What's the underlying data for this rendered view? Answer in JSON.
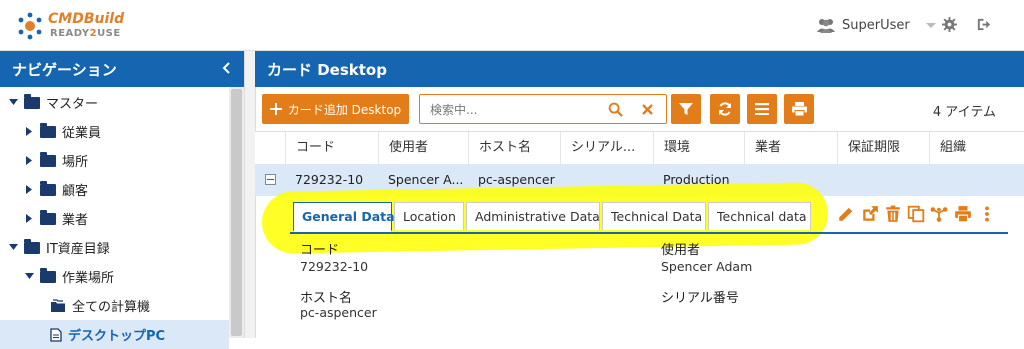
{
  "app": {
    "logo_line1": "CMDBuild",
    "logo_line2_pre": "READY",
    "logo_line2_mid": "2",
    "logo_line2_post": "USE",
    "user_name": "SuperUser"
  },
  "nav": {
    "title": "ナビゲーション",
    "items": [
      {
        "label": "マスター",
        "expanded": true,
        "level": 0
      },
      {
        "label": "従業員",
        "expanded": false,
        "level": 1
      },
      {
        "label": "場所",
        "expanded": false,
        "level": 1
      },
      {
        "label": "顧客",
        "expanded": false,
        "level": 1
      },
      {
        "label": "業者",
        "expanded": false,
        "level": 1
      },
      {
        "label": "IT資産目録",
        "expanded": true,
        "level": 0
      },
      {
        "label": "作業場所",
        "expanded": true,
        "level": 1
      },
      {
        "label": "全ての計算機",
        "level": 2
      },
      {
        "label": "デスクトップPC",
        "level": 2,
        "selected": true
      }
    ]
  },
  "main": {
    "title": "カード Desktop",
    "add_button": "カード追加 Desktop",
    "search_placeholder": "検索中...",
    "item_count": "4 アイテム"
  },
  "grid": {
    "columns": [
      "コード",
      "使用者",
      "ホスト名",
      "シリアル...",
      "環境",
      "業者",
      "保証期限",
      "組織"
    ],
    "rows": [
      [
        "729232-10",
        "Spencer A...",
        "pc-aspencer",
        "",
        "Production",
        "",
        "",
        ""
      ]
    ]
  },
  "detail": {
    "tabs": [
      "General Data",
      "Location",
      "Administrative Data",
      "Technical Data",
      "Technical data"
    ],
    "active_tab": "General Data",
    "fields": [
      {
        "label": "コード",
        "value": "729232-10"
      },
      {
        "label": "使用者",
        "value": "Spencer Adam"
      },
      {
        "label": "ホスト名",
        "value": "pc-aspencer"
      },
      {
        "label": "シリアル番号",
        "value": ""
      }
    ]
  },
  "colors": {
    "primary": "#1565b0",
    "accent": "#e27d1a",
    "selected_row": "#dbe8f7",
    "highlight": "#ffff00"
  },
  "icons": [
    "users-icon",
    "gear-icon",
    "logout-icon",
    "plus-icon",
    "search-icon",
    "clear-icon",
    "filter-icon",
    "refresh-icon",
    "menu-icon",
    "print-icon",
    "edit-icon",
    "open-external-icon",
    "delete-icon",
    "clone-icon",
    "relations-icon",
    "more-icon"
  ]
}
